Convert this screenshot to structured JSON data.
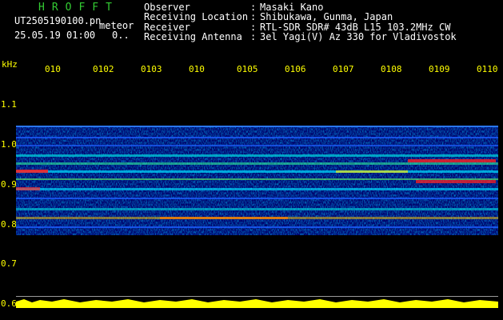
{
  "header": {
    "brand": "HROFFT",
    "file_name": "UT2505190100.pn",
    "mode": "meteor",
    "datetime": "25.05.19 01:00",
    "minutes": "0.."
  },
  "meta": [
    {
      "key": "Observer",
      "value": "Masaki Kano"
    },
    {
      "key": "Receiving Location",
      "value": "Shibukawa, Gunma, Japan"
    },
    {
      "key": "Receiver",
      "value": "RTL-SDR SDR# 43dB L15 103.2MHz CW"
    },
    {
      "key": "Receiving Antenna",
      "value": "3el Yagi(V) Az 330 for Vladivostok"
    }
  ],
  "axes": {
    "y_unit": "kHz",
    "y_ticks": [
      "1.1",
      "1.0",
      "0.9",
      "0.8",
      "0.7",
      "0.6"
    ],
    "x_ticks": [
      "010",
      "0102",
      "0103",
      "010",
      "0105",
      "0106",
      "0107",
      "0108",
      "0109",
      "0110"
    ]
  },
  "colors": {
    "brand": "#33cc33",
    "text": "#ffffff",
    "spectrum_low": "#0000a0",
    "spectrum_mid": "#00ffff",
    "spectrum_high": "#ff0000",
    "power_bar": "#ffff00",
    "tick_text": "#ffff00"
  }
}
